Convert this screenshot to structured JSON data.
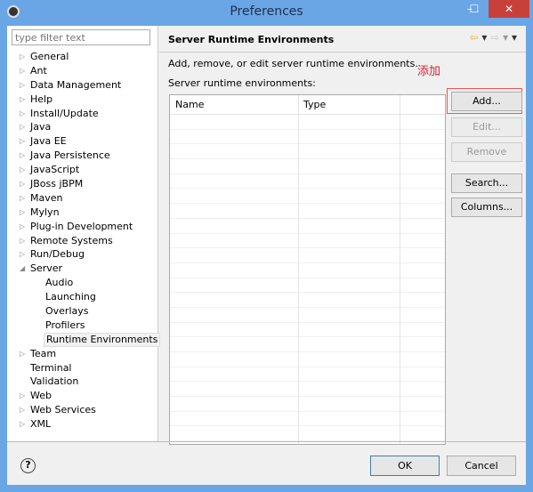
{
  "window": {
    "title": "Preferences",
    "minimize": "–",
    "maximize": "☐",
    "close": "✕"
  },
  "filter": {
    "placeholder": "type filter text"
  },
  "tree": [
    {
      "label": "General",
      "arrow": "▷"
    },
    {
      "label": "Ant",
      "arrow": "▷"
    },
    {
      "label": "Data Management",
      "arrow": "▷"
    },
    {
      "label": "Help",
      "arrow": "▷"
    },
    {
      "label": "Install/Update",
      "arrow": "▷"
    },
    {
      "label": "Java",
      "arrow": "▷"
    },
    {
      "label": "Java EE",
      "arrow": "▷"
    },
    {
      "label": "Java Persistence",
      "arrow": "▷"
    },
    {
      "label": "JavaScript",
      "arrow": "▷"
    },
    {
      "label": "JBoss jBPM",
      "arrow": "▷"
    },
    {
      "label": "Maven",
      "arrow": "▷"
    },
    {
      "label": "Mylyn",
      "arrow": "▷"
    },
    {
      "label": "Plug-in Development",
      "arrow": "▷"
    },
    {
      "label": "Remote Systems",
      "arrow": "▷"
    },
    {
      "label": "Run/Debug",
      "arrow": "▷"
    },
    {
      "label": "Server",
      "arrow": "◢"
    },
    {
      "label": "Audio",
      "sub": true
    },
    {
      "label": "Launching",
      "sub": true
    },
    {
      "label": "Overlays",
      "sub": true
    },
    {
      "label": "Profilers",
      "sub": true
    },
    {
      "label": "Runtime Environments",
      "sub": true,
      "selected": true
    },
    {
      "label": "Team",
      "arrow": "▷"
    },
    {
      "label": "Terminal",
      "arrow": ""
    },
    {
      "label": "Validation",
      "arrow": ""
    },
    {
      "label": "Web",
      "arrow": "▷"
    },
    {
      "label": "Web Services",
      "arrow": "▷"
    },
    {
      "label": "XML",
      "arrow": "▷"
    }
  ],
  "page": {
    "title": "Server Runtime Environments",
    "description": "Add, remove, or edit server runtime environments.",
    "annotation": "添加",
    "list_label": "Server runtime environments:",
    "nav": {
      "back": "⇦",
      "back_menu": "▾",
      "forward": "⇨",
      "forward_menu": "▾",
      "menu": "▾"
    }
  },
  "table": {
    "columns": [
      "Name",
      "Type"
    ],
    "rows": []
  },
  "buttons": {
    "add": "Add...",
    "edit": "Edit...",
    "remove": "Remove",
    "search": "Search...",
    "columns": "Columns..."
  },
  "footer": {
    "help": "?",
    "ok": "OK",
    "cancel": "Cancel"
  }
}
